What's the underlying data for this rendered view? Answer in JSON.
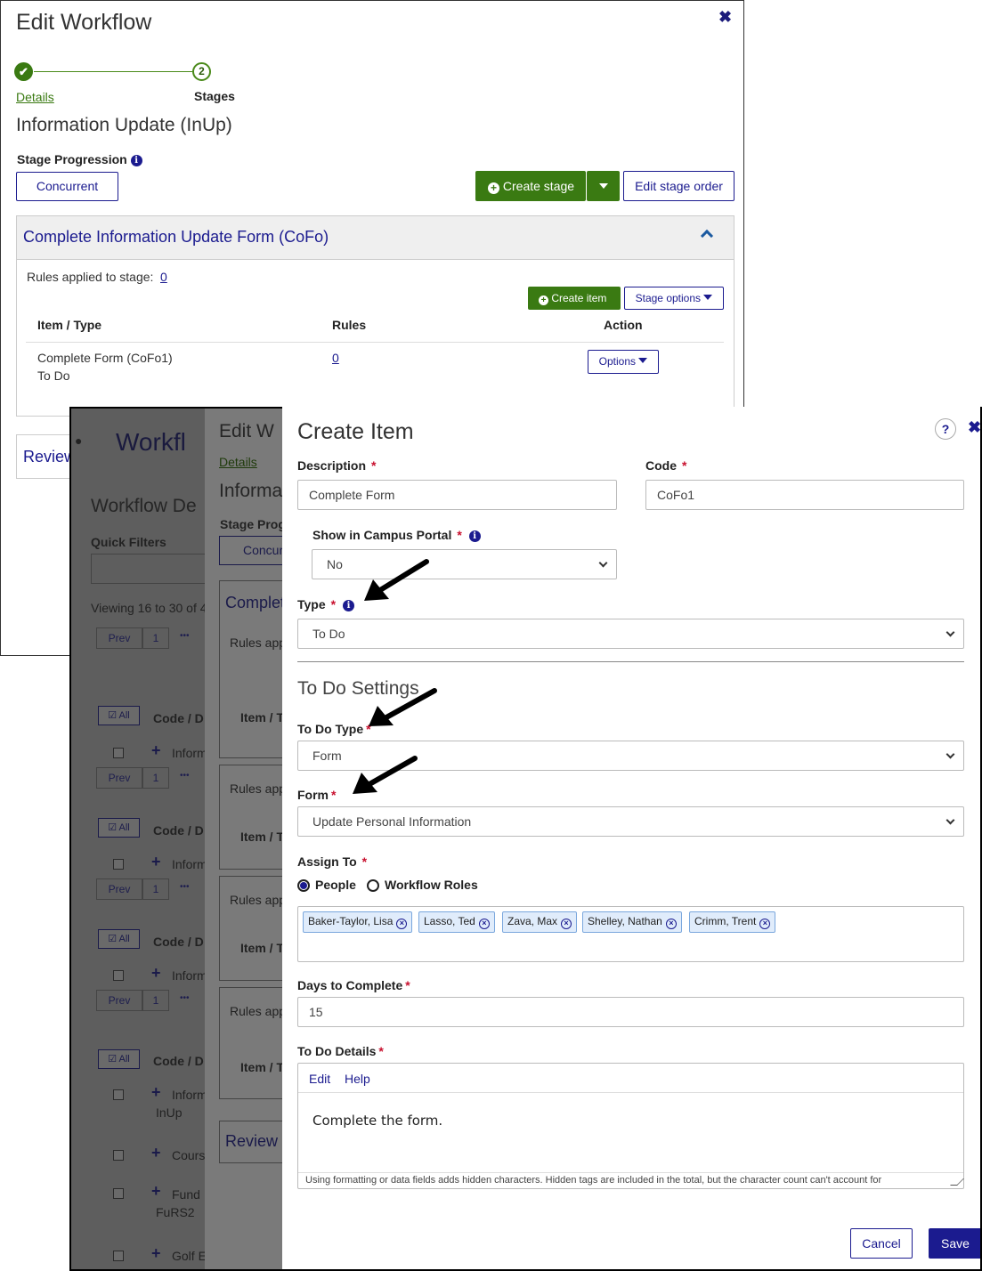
{
  "back_window": {
    "title": "Edit Workflow",
    "close_glyph": "✖",
    "steps": [
      {
        "label": "Details",
        "glyph": "✔"
      },
      {
        "label": "Stages",
        "glyph": "2"
      }
    ],
    "workflow_name": "Information Update (InUp)",
    "stage_progression_label": "Stage Progression",
    "progression_value": "Concurrent",
    "create_stage_label": "Create stage",
    "edit_stage_order_label": "Edit stage order",
    "stage": {
      "title": "Complete Information Update Form (CoFo)",
      "rules_label": "Rules applied to stage:",
      "rules_count": "0",
      "create_item_label": "Create item",
      "stage_options_label": "Stage options",
      "col_item": "Item / Type",
      "col_rules": "Rules",
      "col_action": "Action",
      "row": {
        "item": "Complete Form (CoFo1)",
        "type": "To Do",
        "rules": "0",
        "action": "Options"
      }
    },
    "next_stage_partial": "Review"
  },
  "background_layers": {
    "workflow_title_partial": "Workfl",
    "details_title_partial": "Workflow De",
    "quick_filters": "Quick Filters",
    "viewing_partial": "Viewing 16 to 30 of 4",
    "pager": {
      "prev": "Prev",
      "page": "1",
      "ellipsis": "•••"
    },
    "all_label": "All",
    "code_col_partial": "Code / D",
    "info_partial": "Inform",
    "code_inup": "InUp",
    "course_partial": "Cours",
    "fund_partial": "Fund",
    "fund_code": "FuRS2",
    "golf_partial": "Golf E",
    "edit_w_partial": "Edit W",
    "details_link": "Details",
    "inform_partial2": "Informa",
    "stage_prog_partial": "Stage Prog",
    "concur_partial": "Concur",
    "complet_partial": "Complet",
    "rules_app_partial": "Rules app",
    "item_t_partial": "Item / T",
    "review_partial": "Review"
  },
  "dialog": {
    "title": "Create Item",
    "help_glyph": "?",
    "close_glyph": "✖",
    "description": {
      "label": "Description",
      "value": "Complete Form"
    },
    "code": {
      "label": "Code",
      "value": "CoFo1"
    },
    "portal": {
      "label": "Show in Campus Portal",
      "value": "No"
    },
    "type": {
      "label": "Type",
      "value": "To Do"
    },
    "section_title": "To Do Settings",
    "todo_type": {
      "label": "To Do Type",
      "value": "Form"
    },
    "form": {
      "label": "Form",
      "value": "Update Personal Information"
    },
    "assign_to": {
      "label": "Assign To",
      "option_people": "People",
      "option_roles": "Workflow Roles",
      "selected": "People",
      "people": [
        "Baker-Taylor, Lisa",
        "Lasso, Ted",
        "Zava, Max",
        "Shelley, Nathan",
        "Crimm, Trent"
      ]
    },
    "days": {
      "label": "Days to Complete",
      "value": "15"
    },
    "details": {
      "label": "To Do Details",
      "menu": [
        "Edit",
        "Help"
      ],
      "body": "Complete the form.",
      "status": "Using formatting or data fields adds hidden characters. Hidden tags are included in the total, but the character count can't account for"
    },
    "required_mark": "*",
    "cancel_label": "Cancel",
    "save_label": "Save"
  },
  "colors": {
    "primary": "#1b1b8f",
    "green": "#3a7a12",
    "required": "#c8102e"
  }
}
